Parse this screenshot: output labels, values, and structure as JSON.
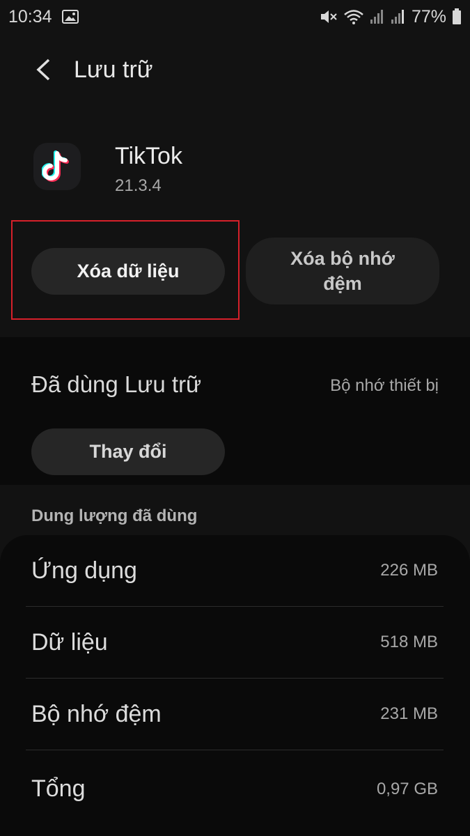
{
  "status_bar": {
    "time": "10:34",
    "battery": "77%",
    "icons": [
      "image-icon",
      "mute-icon",
      "wifi-icon",
      "signal-icon",
      "signal-icon",
      "battery-icon"
    ]
  },
  "header": {
    "title": "Lưu trữ"
  },
  "app": {
    "name": "TikTok",
    "version": "21.3.4",
    "icon": "tiktok-icon"
  },
  "actions": {
    "clear_data_label": "Xóa dữ liệu",
    "clear_cache_label": "Xóa bộ nhớ đệm",
    "highlight_color": "#d6202a"
  },
  "storage": {
    "used_label": "Đã dùng Lưu trữ",
    "location": "Bộ nhớ thiết bị",
    "change_label": "Thay đổi"
  },
  "usage": {
    "section_title": "Dung lượng đã dùng",
    "rows": [
      {
        "label": "Ứng dụng",
        "value": "226 MB"
      },
      {
        "label": "Dữ liệu",
        "value": "518 MB"
      },
      {
        "label": "Bộ nhớ đệm",
        "value": "231 MB"
      },
      {
        "label": "Tổng",
        "value": "0,97 GB"
      }
    ]
  }
}
